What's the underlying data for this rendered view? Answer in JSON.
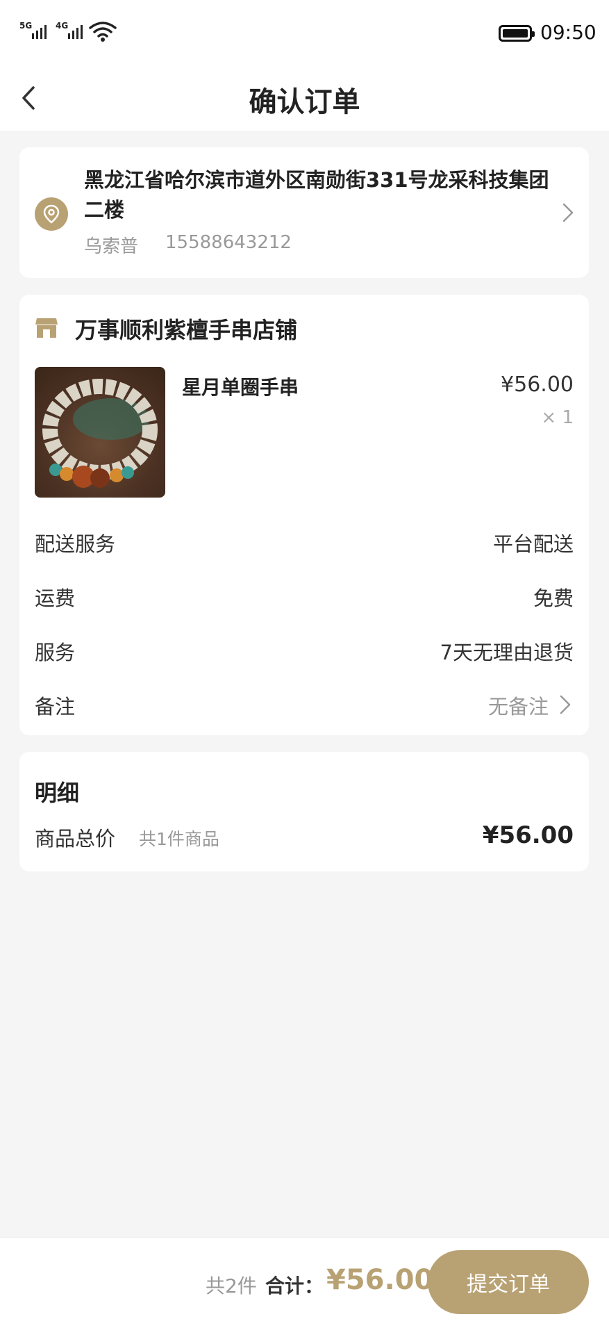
{
  "status_bar": {
    "signal1_label": "5G",
    "signal2_label": "4G",
    "time": "09:50"
  },
  "navbar": {
    "title": "确认订单"
  },
  "address": {
    "text": "黑龙江省哈尔滨市道外区南勋街331号龙采科技集团二楼",
    "recipient": "乌索普",
    "phone": "15588643212"
  },
  "shop": {
    "name": "万事顺利紫檀手串店铺",
    "product": {
      "name": "星月单圈手串",
      "price": "¥56.00",
      "quantity": "× 1"
    },
    "rows": [
      {
        "key": "配送服务",
        "value": "平台配送"
      },
      {
        "key": "运费",
        "value": "免费"
      },
      {
        "key": "服务",
        "value": "7天无理由退货"
      },
      {
        "key": "备注",
        "value": "无备注"
      }
    ]
  },
  "detail": {
    "title": "明细",
    "label": "商品总价",
    "count": "共1件商品",
    "amount": "¥56.00"
  },
  "bottom": {
    "count": "共2件",
    "label": "合计：",
    "total": "¥56.00",
    "submit_label": "提交订单"
  },
  "colors": {
    "accent": "#b8a173",
    "background": "#f5f5f5"
  }
}
